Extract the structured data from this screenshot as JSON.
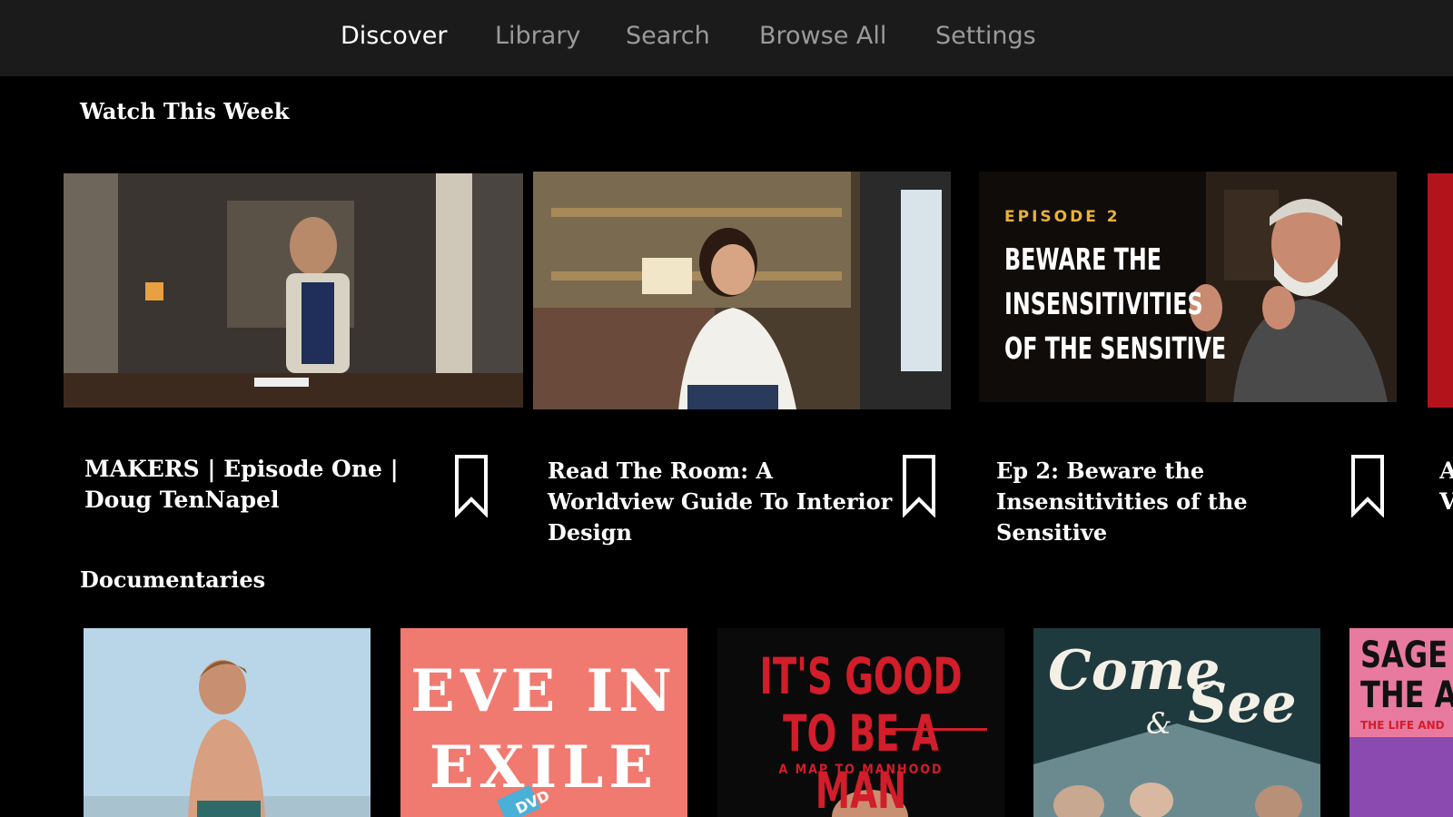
{
  "nav": {
    "items": [
      "Discover",
      "Library",
      "Search",
      "Browse All",
      "Settings"
    ],
    "active": "Discover"
  },
  "sections": {
    "watch_this_week": "Watch This Week",
    "documentaries": "Documentaries"
  },
  "hero_cards": [
    {
      "title": "MAKERS | Episode One | Doug TenNapel"
    },
    {
      "title": "Read The Room: A Worldview Guide To Interior Design"
    },
    {
      "title": "Ep 2: Beware the Insensitivities of the Sensitive",
      "image_eyebrow": "EPISODE 2",
      "image_lines": [
        "BEWARE THE",
        "INSENSITIVITIES",
        "OF THE SENSITIVE"
      ]
    }
  ],
  "partial_card_title_glyphs": [
    "A",
    "V"
  ],
  "posters": [
    {
      "lines": []
    },
    {
      "lines": [
        "EVE IN",
        "EXILE"
      ],
      "sticker": "DVD"
    },
    {
      "lines": [
        "IT'S GOOD",
        "TO BE A MAN"
      ],
      "subtitle": "A MAP TO MANHOOD"
    },
    {
      "lines": [
        "Come",
        "See"
      ],
      "ampersand": "&"
    },
    {
      "lines": [
        "SAGE",
        "THE A"
      ],
      "subtitle": "THE LIFE AND"
    }
  ],
  "colors": {
    "background": "#000000",
    "topbar": "#1b1b1b",
    "nav_inactive": "#9a9a9a",
    "nav_active": "#ffffff",
    "accent_yellow": "#e8b23a",
    "eve_pink": "#f07a70",
    "man_red": "#d21d2a"
  }
}
